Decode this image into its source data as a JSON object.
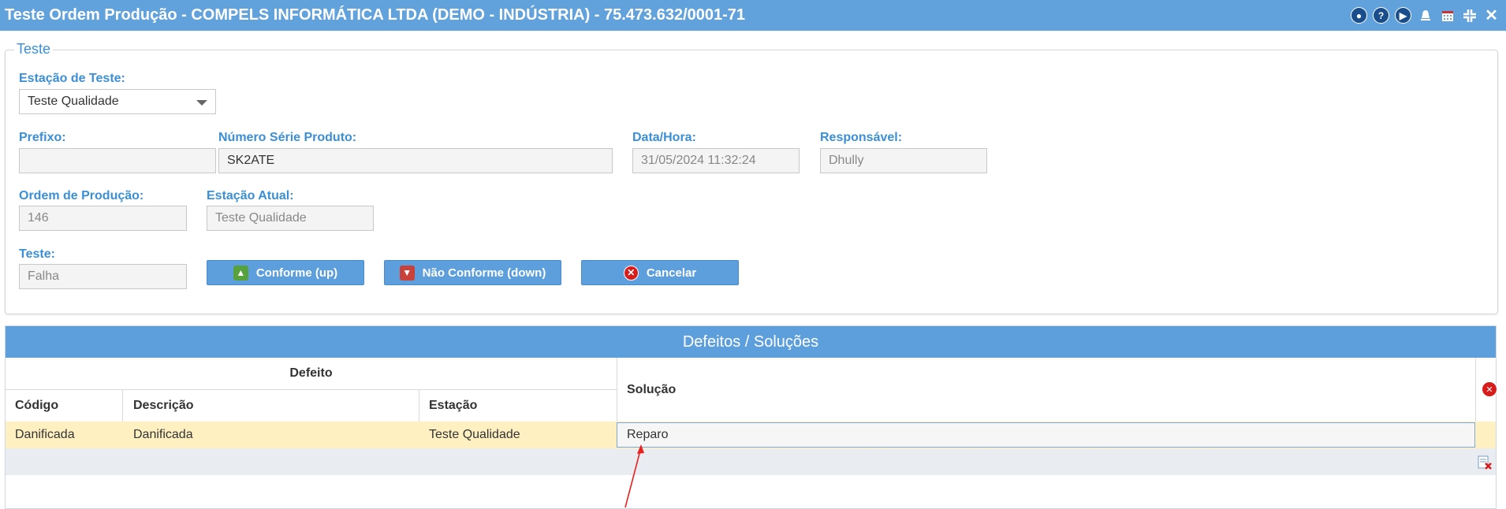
{
  "window": {
    "title": "Teste Ordem Produção - COMPELS INFORMÁTICA LTDA (DEMO - INDÚSTRIA) - 75.473.632/0001-71",
    "icons": [
      "restore-icon",
      "help-icon",
      "play-icon",
      "bell-icon",
      "calendar-icon",
      "compress-icon",
      "close-icon"
    ]
  },
  "form": {
    "legend": "Teste",
    "estacao_teste": {
      "label": "Estação de Teste:",
      "value": "Teste Qualidade"
    },
    "prefixo": {
      "label": "Prefixo:",
      "value": ""
    },
    "numero_serie": {
      "label": "Número Série Produto:",
      "value": "SK2ATE"
    },
    "data_hora": {
      "label": "Data/Hora:",
      "value": "31/05/2024 11:32:24"
    },
    "responsavel": {
      "label": "Responsável:",
      "value": "Dhully"
    },
    "ordem_producao": {
      "label": "Ordem de Produção:",
      "value": "146"
    },
    "estacao_atual": {
      "label": "Estação Atual:",
      "value": "Teste Qualidade"
    },
    "teste": {
      "label": "Teste:",
      "value": "Falha"
    },
    "buttons": {
      "conforme": "Conforme (up)",
      "nao_conforme": "Não Conforme (down)",
      "cancelar": "Cancelar"
    }
  },
  "grid": {
    "title": "Defeitos / Soluções",
    "group_header": "Defeito",
    "columns": {
      "codigo": "Código",
      "descricao": "Descrição",
      "estacao": "Estação",
      "solucao": "Solução"
    },
    "rows": [
      {
        "codigo": "Danificada",
        "descricao": "Danificada",
        "estacao": "Teste Qualidade",
        "solucao": "Reparo"
      }
    ]
  },
  "colors": {
    "accent": "#5d9fdc",
    "label": "#3a8fd6",
    "selected_row": "#fff0c2",
    "danger": "#d81c1c"
  }
}
